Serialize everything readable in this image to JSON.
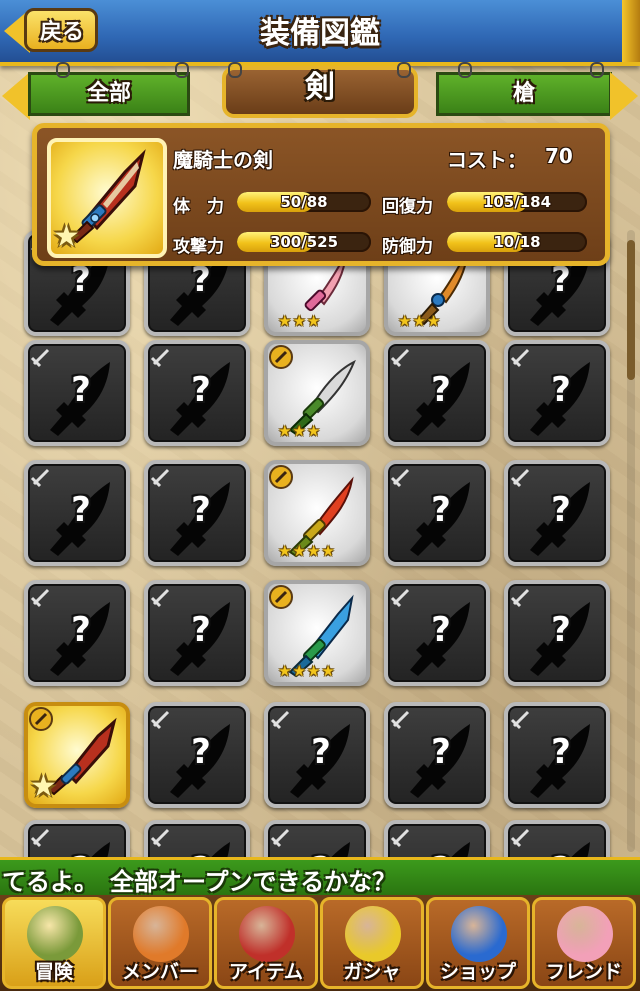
{
  "header": {
    "title": "装備図鑑",
    "back_label": "戻る"
  },
  "tabs": {
    "left": "全部",
    "center": "剣",
    "right": "槍"
  },
  "detail": {
    "name": "魔騎士の剣",
    "cost_label": "コスト：",
    "cost_value": "70",
    "stats": [
      {
        "label": "体　力",
        "value": "50/88",
        "fraction": 0.57
      },
      {
        "label": "回復力",
        "value": "105/184",
        "fraction": 0.57
      },
      {
        "label": "攻撃力",
        "value": "300/525",
        "fraction": 0.57
      },
      {
        "label": "防御力",
        "value": "10/18",
        "fraction": 0.56
      }
    ]
  },
  "grid": {
    "rows": [
      [
        "locked",
        "locked",
        "open3",
        "open3",
        "locked"
      ],
      [
        "locked",
        "locked",
        "open3",
        "locked",
        "locked"
      ],
      [
        "locked",
        "locked",
        "open4",
        "locked",
        "locked"
      ],
      [
        "locked",
        "locked",
        "open4",
        "locked",
        "locked"
      ],
      [
        "gold1",
        "locked",
        "locked",
        "locked",
        "locked"
      ],
      [
        "locked",
        "locked",
        "locked",
        "locked",
        "locked"
      ]
    ],
    "unknown_mark": "?"
  },
  "ticker": "てるよ。　全部オープンできるかな？",
  "nav": [
    {
      "label": "冒険",
      "icon": "adventure-bag-icon",
      "color": "#7a9a3a"
    },
    {
      "label": "メンバー",
      "icon": "paw-icon",
      "color": "#e07a2a"
    },
    {
      "label": "アイテム",
      "icon": "treasure-chest-icon",
      "color": "#c0302a"
    },
    {
      "label": "ガシャ",
      "icon": "gacha-ball-icon",
      "color": "#e9c92a"
    },
    {
      "label": "ショップ",
      "icon": "crystal-orb-icon",
      "color": "#2a6ad0"
    },
    {
      "label": "フレンド",
      "icon": "cat-friends-icon",
      "color": "#f2a0b8"
    }
  ],
  "colors": {
    "header_blue": "#2f67b4",
    "gold": "#e6b42a",
    "green": "#3b8217",
    "wood": "#6e3f18"
  }
}
